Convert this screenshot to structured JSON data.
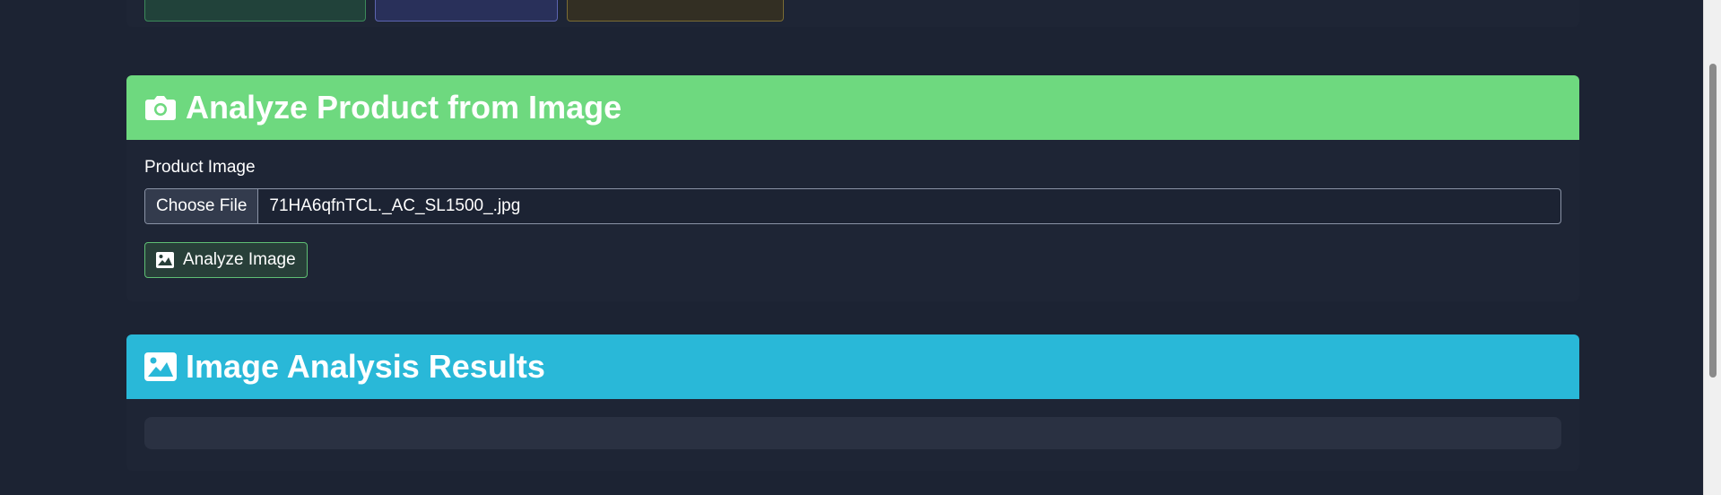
{
  "image_section": {
    "title": "Analyze Product from Image",
    "icon": "camera-icon",
    "header_color": "#6ed97f",
    "field_label": "Product Image",
    "choose_file_label": "Choose File",
    "file_name": "71HA6qfnTCL._AC_SL1500_.jpg",
    "analyze_button_label": "Analyze Image",
    "analyze_button_icon": "image-icon"
  },
  "results_section": {
    "title": "Image Analysis Results",
    "icon": "image-icon",
    "header_color": "#29b8d8",
    "content": ""
  }
}
